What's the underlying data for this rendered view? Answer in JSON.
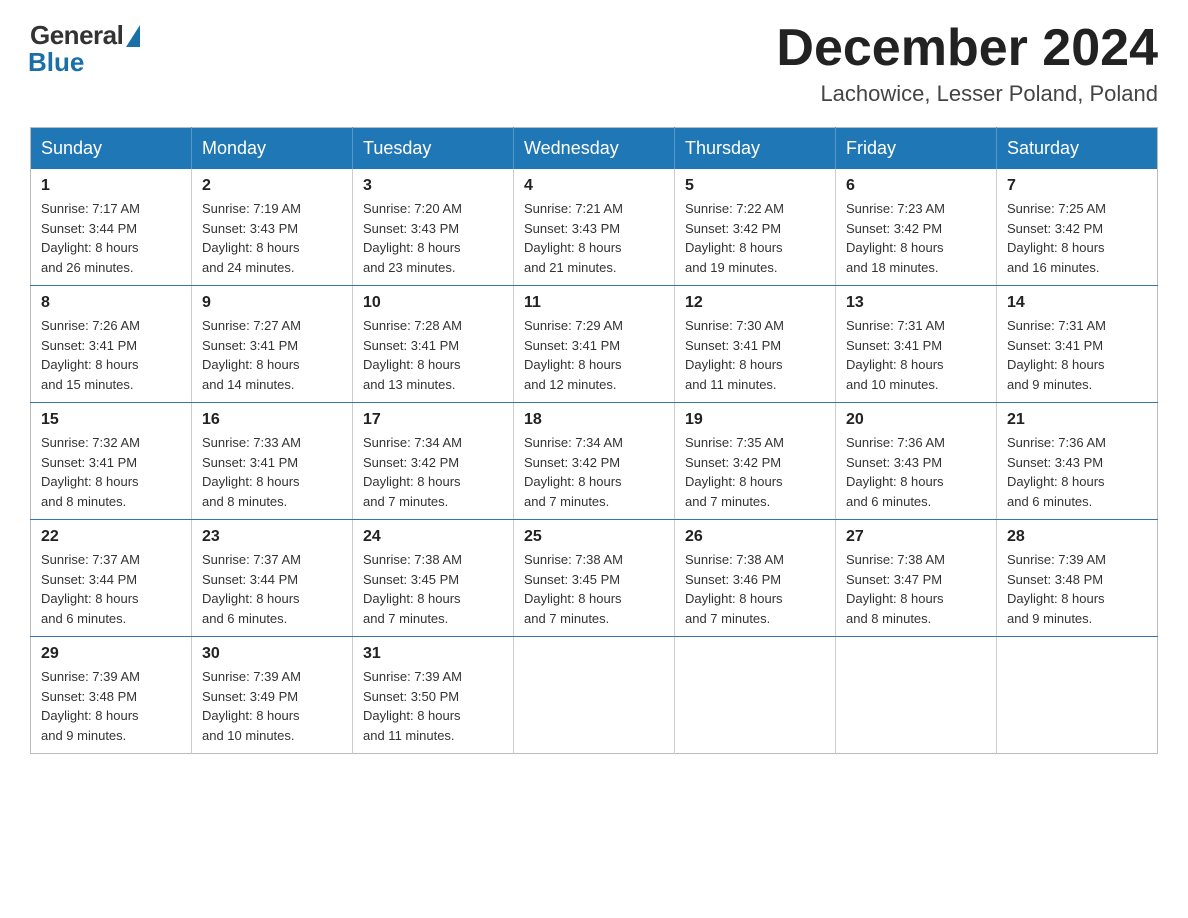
{
  "logo": {
    "general": "General",
    "blue": "Blue"
  },
  "header": {
    "month": "December 2024",
    "location": "Lachowice, Lesser Poland, Poland"
  },
  "weekdays": [
    "Sunday",
    "Monday",
    "Tuesday",
    "Wednesday",
    "Thursday",
    "Friday",
    "Saturday"
  ],
  "weeks": [
    [
      {
        "day": "1",
        "sunrise": "7:17 AM",
        "sunset": "3:44 PM",
        "daylight": "8 hours and 26 minutes."
      },
      {
        "day": "2",
        "sunrise": "7:19 AM",
        "sunset": "3:43 PM",
        "daylight": "8 hours and 24 minutes."
      },
      {
        "day": "3",
        "sunrise": "7:20 AM",
        "sunset": "3:43 PM",
        "daylight": "8 hours and 23 minutes."
      },
      {
        "day": "4",
        "sunrise": "7:21 AM",
        "sunset": "3:43 PM",
        "daylight": "8 hours and 21 minutes."
      },
      {
        "day": "5",
        "sunrise": "7:22 AM",
        "sunset": "3:42 PM",
        "daylight": "8 hours and 19 minutes."
      },
      {
        "day": "6",
        "sunrise": "7:23 AM",
        "sunset": "3:42 PM",
        "daylight": "8 hours and 18 minutes."
      },
      {
        "day": "7",
        "sunrise": "7:25 AM",
        "sunset": "3:42 PM",
        "daylight": "8 hours and 16 minutes."
      }
    ],
    [
      {
        "day": "8",
        "sunrise": "7:26 AM",
        "sunset": "3:41 PM",
        "daylight": "8 hours and 15 minutes."
      },
      {
        "day": "9",
        "sunrise": "7:27 AM",
        "sunset": "3:41 PM",
        "daylight": "8 hours and 14 minutes."
      },
      {
        "day": "10",
        "sunrise": "7:28 AM",
        "sunset": "3:41 PM",
        "daylight": "8 hours and 13 minutes."
      },
      {
        "day": "11",
        "sunrise": "7:29 AM",
        "sunset": "3:41 PM",
        "daylight": "8 hours and 12 minutes."
      },
      {
        "day": "12",
        "sunrise": "7:30 AM",
        "sunset": "3:41 PM",
        "daylight": "8 hours and 11 minutes."
      },
      {
        "day": "13",
        "sunrise": "7:31 AM",
        "sunset": "3:41 PM",
        "daylight": "8 hours and 10 minutes."
      },
      {
        "day": "14",
        "sunrise": "7:31 AM",
        "sunset": "3:41 PM",
        "daylight": "8 hours and 9 minutes."
      }
    ],
    [
      {
        "day": "15",
        "sunrise": "7:32 AM",
        "sunset": "3:41 PM",
        "daylight": "8 hours and 8 minutes."
      },
      {
        "day": "16",
        "sunrise": "7:33 AM",
        "sunset": "3:41 PM",
        "daylight": "8 hours and 8 minutes."
      },
      {
        "day": "17",
        "sunrise": "7:34 AM",
        "sunset": "3:42 PM",
        "daylight": "8 hours and 7 minutes."
      },
      {
        "day": "18",
        "sunrise": "7:34 AM",
        "sunset": "3:42 PM",
        "daylight": "8 hours and 7 minutes."
      },
      {
        "day": "19",
        "sunrise": "7:35 AM",
        "sunset": "3:42 PM",
        "daylight": "8 hours and 7 minutes."
      },
      {
        "day": "20",
        "sunrise": "7:36 AM",
        "sunset": "3:43 PM",
        "daylight": "8 hours and 6 minutes."
      },
      {
        "day": "21",
        "sunrise": "7:36 AM",
        "sunset": "3:43 PM",
        "daylight": "8 hours and 6 minutes."
      }
    ],
    [
      {
        "day": "22",
        "sunrise": "7:37 AM",
        "sunset": "3:44 PM",
        "daylight": "8 hours and 6 minutes."
      },
      {
        "day": "23",
        "sunrise": "7:37 AM",
        "sunset": "3:44 PM",
        "daylight": "8 hours and 6 minutes."
      },
      {
        "day": "24",
        "sunrise": "7:38 AM",
        "sunset": "3:45 PM",
        "daylight": "8 hours and 7 minutes."
      },
      {
        "day": "25",
        "sunrise": "7:38 AM",
        "sunset": "3:45 PM",
        "daylight": "8 hours and 7 minutes."
      },
      {
        "day": "26",
        "sunrise": "7:38 AM",
        "sunset": "3:46 PM",
        "daylight": "8 hours and 7 minutes."
      },
      {
        "day": "27",
        "sunrise": "7:38 AM",
        "sunset": "3:47 PM",
        "daylight": "8 hours and 8 minutes."
      },
      {
        "day": "28",
        "sunrise": "7:39 AM",
        "sunset": "3:48 PM",
        "daylight": "8 hours and 9 minutes."
      }
    ],
    [
      {
        "day": "29",
        "sunrise": "7:39 AM",
        "sunset": "3:48 PM",
        "daylight": "8 hours and 9 minutes."
      },
      {
        "day": "30",
        "sunrise": "7:39 AM",
        "sunset": "3:49 PM",
        "daylight": "8 hours and 10 minutes."
      },
      {
        "day": "31",
        "sunrise": "7:39 AM",
        "sunset": "3:50 PM",
        "daylight": "8 hours and 11 minutes."
      },
      null,
      null,
      null,
      null
    ]
  ],
  "labels": {
    "sunrise": "Sunrise: ",
    "sunset": "Sunset: ",
    "daylight": "Daylight: "
  }
}
